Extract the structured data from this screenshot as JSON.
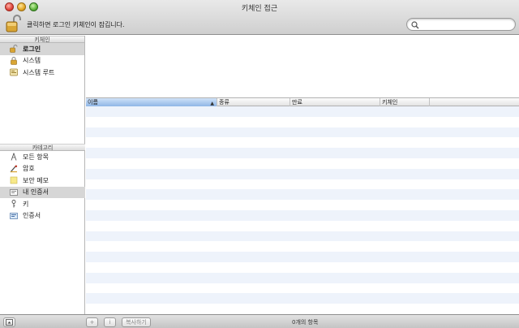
{
  "window": {
    "title": "키체인 접근"
  },
  "toolbar": {
    "lock_text": "클릭하면 로그인 키체인이 잠깁니다.",
    "search_placeholder": ""
  },
  "sidebar": {
    "keychains_header": "키체인",
    "keychains": [
      {
        "label": "로그인",
        "icon": "login-keychain-icon",
        "selected": true
      },
      {
        "label": "시스템",
        "icon": "system-lock-icon",
        "selected": false
      },
      {
        "label": "시스템 루트",
        "icon": "system-root-icon",
        "selected": false
      }
    ],
    "categories_header": "카테고리",
    "categories": [
      {
        "label": "모든 항목",
        "icon": "all-items-icon",
        "selected": false
      },
      {
        "label": "암호",
        "icon": "password-icon",
        "selected": false
      },
      {
        "label": "보안 메모",
        "icon": "secure-note-icon",
        "selected": false
      },
      {
        "label": "내 인증서",
        "icon": "my-certificate-icon",
        "selected": true
      },
      {
        "label": "키",
        "icon": "key-icon",
        "selected": false
      },
      {
        "label": "인증서",
        "icon": "certificate-icon",
        "selected": false
      }
    ]
  },
  "table": {
    "columns": [
      "이름",
      "종류",
      "만료",
      "키체인"
    ],
    "sort_indicator": "▲",
    "rows": []
  },
  "bottombar": {
    "add_label": "+",
    "info_label": "i",
    "copy_label": "복사하기",
    "count_text": "0개의 항목"
  },
  "colors": {
    "selection_gray": "#d6d6d6",
    "sorted_column": "#8fb6e6",
    "alt_row": "#eef3fb"
  }
}
